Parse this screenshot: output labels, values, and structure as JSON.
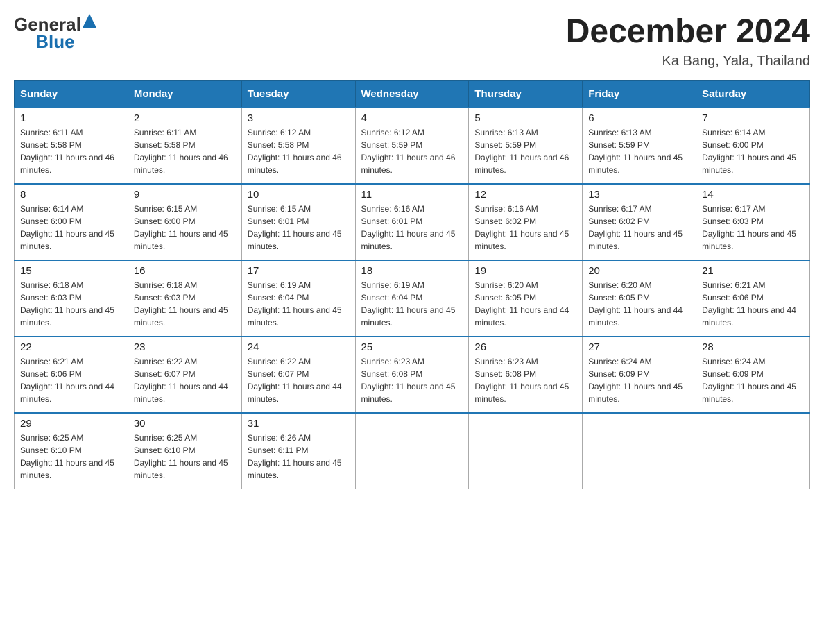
{
  "header": {
    "logo_general": "General",
    "logo_blue": "Blue",
    "month_title": "December 2024",
    "location": "Ka Bang, Yala, Thailand"
  },
  "days_of_week": [
    "Sunday",
    "Monday",
    "Tuesday",
    "Wednesday",
    "Thursday",
    "Friday",
    "Saturday"
  ],
  "weeks": [
    [
      {
        "day": "1",
        "sunrise": "Sunrise: 6:11 AM",
        "sunset": "Sunset: 5:58 PM",
        "daylight": "Daylight: 11 hours and 46 minutes."
      },
      {
        "day": "2",
        "sunrise": "Sunrise: 6:11 AM",
        "sunset": "Sunset: 5:58 PM",
        "daylight": "Daylight: 11 hours and 46 minutes."
      },
      {
        "day": "3",
        "sunrise": "Sunrise: 6:12 AM",
        "sunset": "Sunset: 5:58 PM",
        "daylight": "Daylight: 11 hours and 46 minutes."
      },
      {
        "day": "4",
        "sunrise": "Sunrise: 6:12 AM",
        "sunset": "Sunset: 5:59 PM",
        "daylight": "Daylight: 11 hours and 46 minutes."
      },
      {
        "day": "5",
        "sunrise": "Sunrise: 6:13 AM",
        "sunset": "Sunset: 5:59 PM",
        "daylight": "Daylight: 11 hours and 46 minutes."
      },
      {
        "day": "6",
        "sunrise": "Sunrise: 6:13 AM",
        "sunset": "Sunset: 5:59 PM",
        "daylight": "Daylight: 11 hours and 45 minutes."
      },
      {
        "day": "7",
        "sunrise": "Sunrise: 6:14 AM",
        "sunset": "Sunset: 6:00 PM",
        "daylight": "Daylight: 11 hours and 45 minutes."
      }
    ],
    [
      {
        "day": "8",
        "sunrise": "Sunrise: 6:14 AM",
        "sunset": "Sunset: 6:00 PM",
        "daylight": "Daylight: 11 hours and 45 minutes."
      },
      {
        "day": "9",
        "sunrise": "Sunrise: 6:15 AM",
        "sunset": "Sunset: 6:00 PM",
        "daylight": "Daylight: 11 hours and 45 minutes."
      },
      {
        "day": "10",
        "sunrise": "Sunrise: 6:15 AM",
        "sunset": "Sunset: 6:01 PM",
        "daylight": "Daylight: 11 hours and 45 minutes."
      },
      {
        "day": "11",
        "sunrise": "Sunrise: 6:16 AM",
        "sunset": "Sunset: 6:01 PM",
        "daylight": "Daylight: 11 hours and 45 minutes."
      },
      {
        "day": "12",
        "sunrise": "Sunrise: 6:16 AM",
        "sunset": "Sunset: 6:02 PM",
        "daylight": "Daylight: 11 hours and 45 minutes."
      },
      {
        "day": "13",
        "sunrise": "Sunrise: 6:17 AM",
        "sunset": "Sunset: 6:02 PM",
        "daylight": "Daylight: 11 hours and 45 minutes."
      },
      {
        "day": "14",
        "sunrise": "Sunrise: 6:17 AM",
        "sunset": "Sunset: 6:03 PM",
        "daylight": "Daylight: 11 hours and 45 minutes."
      }
    ],
    [
      {
        "day": "15",
        "sunrise": "Sunrise: 6:18 AM",
        "sunset": "Sunset: 6:03 PM",
        "daylight": "Daylight: 11 hours and 45 minutes."
      },
      {
        "day": "16",
        "sunrise": "Sunrise: 6:18 AM",
        "sunset": "Sunset: 6:03 PM",
        "daylight": "Daylight: 11 hours and 45 minutes."
      },
      {
        "day": "17",
        "sunrise": "Sunrise: 6:19 AM",
        "sunset": "Sunset: 6:04 PM",
        "daylight": "Daylight: 11 hours and 45 minutes."
      },
      {
        "day": "18",
        "sunrise": "Sunrise: 6:19 AM",
        "sunset": "Sunset: 6:04 PM",
        "daylight": "Daylight: 11 hours and 45 minutes."
      },
      {
        "day": "19",
        "sunrise": "Sunrise: 6:20 AM",
        "sunset": "Sunset: 6:05 PM",
        "daylight": "Daylight: 11 hours and 44 minutes."
      },
      {
        "day": "20",
        "sunrise": "Sunrise: 6:20 AM",
        "sunset": "Sunset: 6:05 PM",
        "daylight": "Daylight: 11 hours and 44 minutes."
      },
      {
        "day": "21",
        "sunrise": "Sunrise: 6:21 AM",
        "sunset": "Sunset: 6:06 PM",
        "daylight": "Daylight: 11 hours and 44 minutes."
      }
    ],
    [
      {
        "day": "22",
        "sunrise": "Sunrise: 6:21 AM",
        "sunset": "Sunset: 6:06 PM",
        "daylight": "Daylight: 11 hours and 44 minutes."
      },
      {
        "day": "23",
        "sunrise": "Sunrise: 6:22 AM",
        "sunset": "Sunset: 6:07 PM",
        "daylight": "Daylight: 11 hours and 44 minutes."
      },
      {
        "day": "24",
        "sunrise": "Sunrise: 6:22 AM",
        "sunset": "Sunset: 6:07 PM",
        "daylight": "Daylight: 11 hours and 44 minutes."
      },
      {
        "day": "25",
        "sunrise": "Sunrise: 6:23 AM",
        "sunset": "Sunset: 6:08 PM",
        "daylight": "Daylight: 11 hours and 45 minutes."
      },
      {
        "day": "26",
        "sunrise": "Sunrise: 6:23 AM",
        "sunset": "Sunset: 6:08 PM",
        "daylight": "Daylight: 11 hours and 45 minutes."
      },
      {
        "day": "27",
        "sunrise": "Sunrise: 6:24 AM",
        "sunset": "Sunset: 6:09 PM",
        "daylight": "Daylight: 11 hours and 45 minutes."
      },
      {
        "day": "28",
        "sunrise": "Sunrise: 6:24 AM",
        "sunset": "Sunset: 6:09 PM",
        "daylight": "Daylight: 11 hours and 45 minutes."
      }
    ],
    [
      {
        "day": "29",
        "sunrise": "Sunrise: 6:25 AM",
        "sunset": "Sunset: 6:10 PM",
        "daylight": "Daylight: 11 hours and 45 minutes."
      },
      {
        "day": "30",
        "sunrise": "Sunrise: 6:25 AM",
        "sunset": "Sunset: 6:10 PM",
        "daylight": "Daylight: 11 hours and 45 minutes."
      },
      {
        "day": "31",
        "sunrise": "Sunrise: 6:26 AM",
        "sunset": "Sunset: 6:11 PM",
        "daylight": "Daylight: 11 hours and 45 minutes."
      },
      {
        "day": "",
        "sunrise": "",
        "sunset": "",
        "daylight": ""
      },
      {
        "day": "",
        "sunrise": "",
        "sunset": "",
        "daylight": ""
      },
      {
        "day": "",
        "sunrise": "",
        "sunset": "",
        "daylight": ""
      },
      {
        "day": "",
        "sunrise": "",
        "sunset": "",
        "daylight": ""
      }
    ]
  ]
}
